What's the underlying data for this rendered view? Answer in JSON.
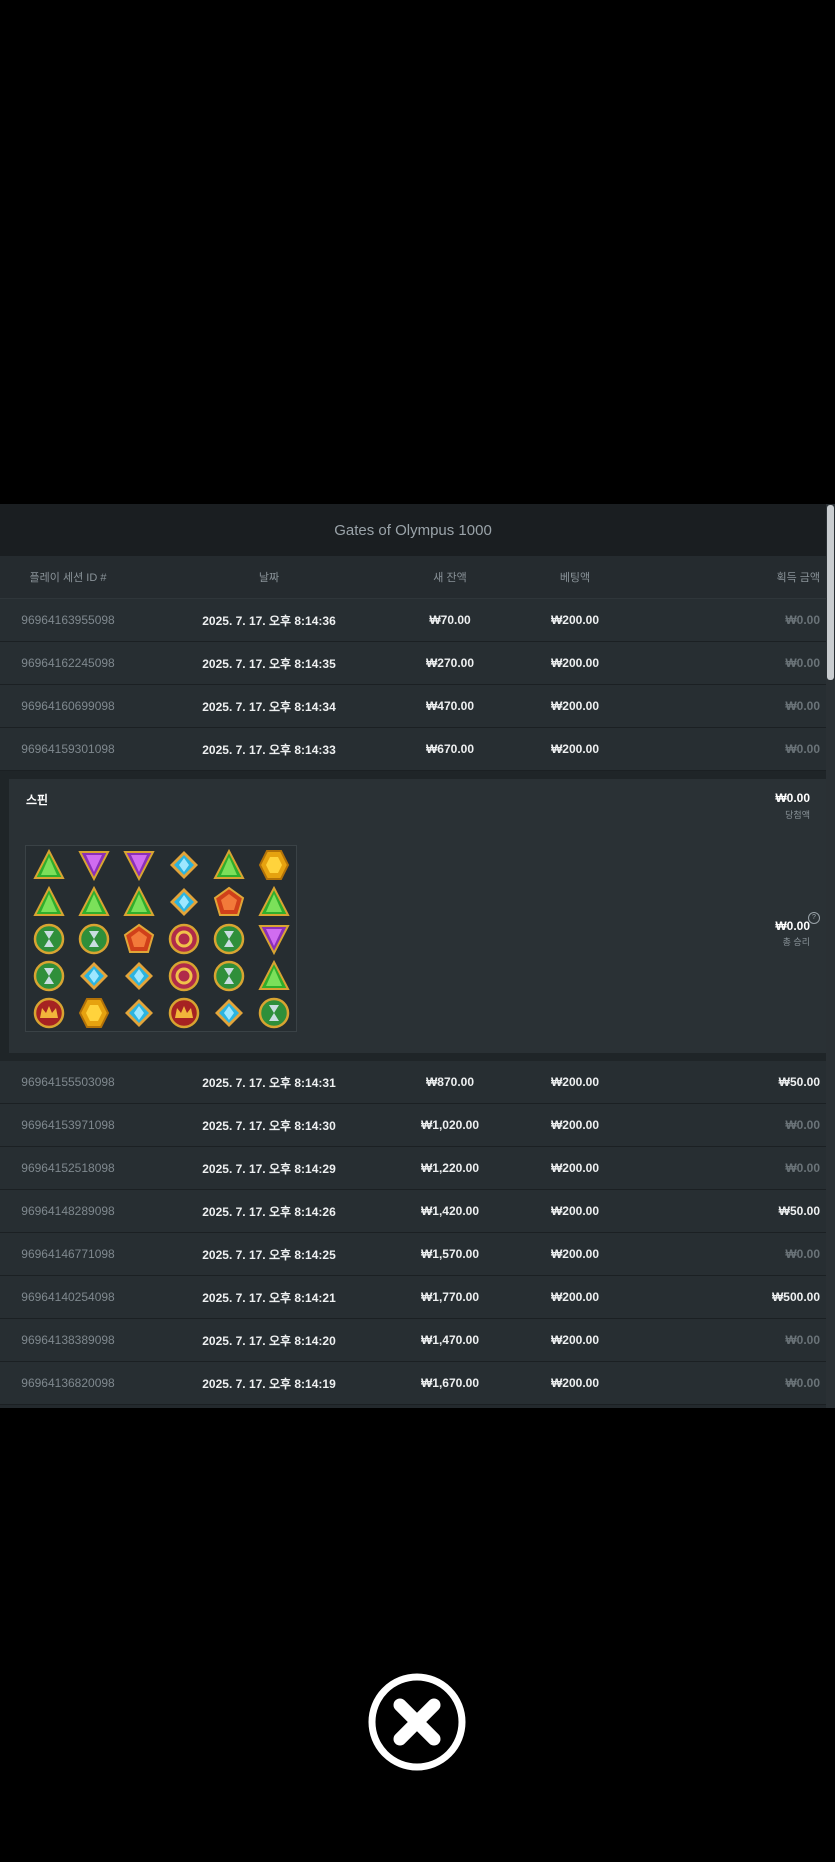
{
  "title": "Gates of Olympus 1000",
  "columns": [
    "플레이 세션 ID #",
    "날짜",
    "새 잔액",
    "베팅액",
    "획득 금액"
  ],
  "rows_top": [
    {
      "id": "96964163955098",
      "date": "2025. 7. 17. 오후 8:14:36",
      "balance": "₩70.00",
      "bet": "₩200.00",
      "win": "₩0.00",
      "is_win": false
    },
    {
      "id": "96964162245098",
      "date": "2025. 7. 17. 오후 8:14:35",
      "balance": "₩270.00",
      "bet": "₩200.00",
      "win": "₩0.00",
      "is_win": false
    },
    {
      "id": "96964160699098",
      "date": "2025. 7. 17. 오후 8:14:34",
      "balance": "₩470.00",
      "bet": "₩200.00",
      "win": "₩0.00",
      "is_win": false
    },
    {
      "id": "96964159301098",
      "date": "2025. 7. 17. 오후 8:14:33",
      "balance": "₩670.00",
      "bet": "₩200.00",
      "win": "₩0.00",
      "is_win": false
    }
  ],
  "detail": {
    "spin_label": "스핀",
    "win_amount": "₩0.00",
    "win_label": "당첨액",
    "total_amount": "₩0.00",
    "total_label": "총 승리",
    "help": "?",
    "grid": [
      [
        "green-triangle",
        "purple-triangle",
        "purple-triangle",
        "blue-diamond",
        "green-triangle",
        "yellow-hexagon"
      ],
      [
        "green-triangle",
        "green-triangle",
        "green-triangle",
        "blue-diamond",
        "red-pentagon",
        "green-triangle"
      ],
      [
        "hourglass-orb",
        "hourglass-orb",
        "red-pentagon",
        "ring-orb",
        "hourglass-orb",
        "purple-triangle"
      ],
      [
        "hourglass-orb",
        "blue-diamond",
        "blue-diamond",
        "ring-orb",
        "hourglass-orb",
        "green-triangle"
      ],
      [
        "crown-orb",
        "yellow-hexagon",
        "blue-diamond",
        "crown-orb",
        "blue-diamond",
        "hourglass-orb"
      ]
    ]
  },
  "rows_bottom": [
    {
      "id": "96964155503098",
      "date": "2025. 7. 17. 오후 8:14:31",
      "balance": "₩870.00",
      "bet": "₩200.00",
      "win": "₩50.00",
      "is_win": true
    },
    {
      "id": "96964153971098",
      "date": "2025. 7. 17. 오후 8:14:30",
      "balance": "₩1,020.00",
      "bet": "₩200.00",
      "win": "₩0.00",
      "is_win": false
    },
    {
      "id": "96964152518098",
      "date": "2025. 7. 17. 오후 8:14:29",
      "balance": "₩1,220.00",
      "bet": "₩200.00",
      "win": "₩0.00",
      "is_win": false
    },
    {
      "id": "96964148289098",
      "date": "2025. 7. 17. 오후 8:14:26",
      "balance": "₩1,420.00",
      "bet": "₩200.00",
      "win": "₩50.00",
      "is_win": true
    },
    {
      "id": "96964146771098",
      "date": "2025. 7. 17. 오후 8:14:25",
      "balance": "₩1,570.00",
      "bet": "₩200.00",
      "win": "₩0.00",
      "is_win": false
    },
    {
      "id": "96964140254098",
      "date": "2025. 7. 17. 오후 8:14:21",
      "balance": "₩1,770.00",
      "bet": "₩200.00",
      "win": "₩500.00",
      "is_win": true
    },
    {
      "id": "96964138389098",
      "date": "2025. 7. 17. 오후 8:14:20",
      "balance": "₩1,470.00",
      "bet": "₩200.00",
      "win": "₩0.00",
      "is_win": false
    },
    {
      "id": "96964136820098",
      "date": "2025. 7. 17. 오후 8:14:19",
      "balance": "₩1,670.00",
      "bet": "₩200.00",
      "win": "₩0.00",
      "is_win": false
    }
  ],
  "close_icon": "close-icon"
}
